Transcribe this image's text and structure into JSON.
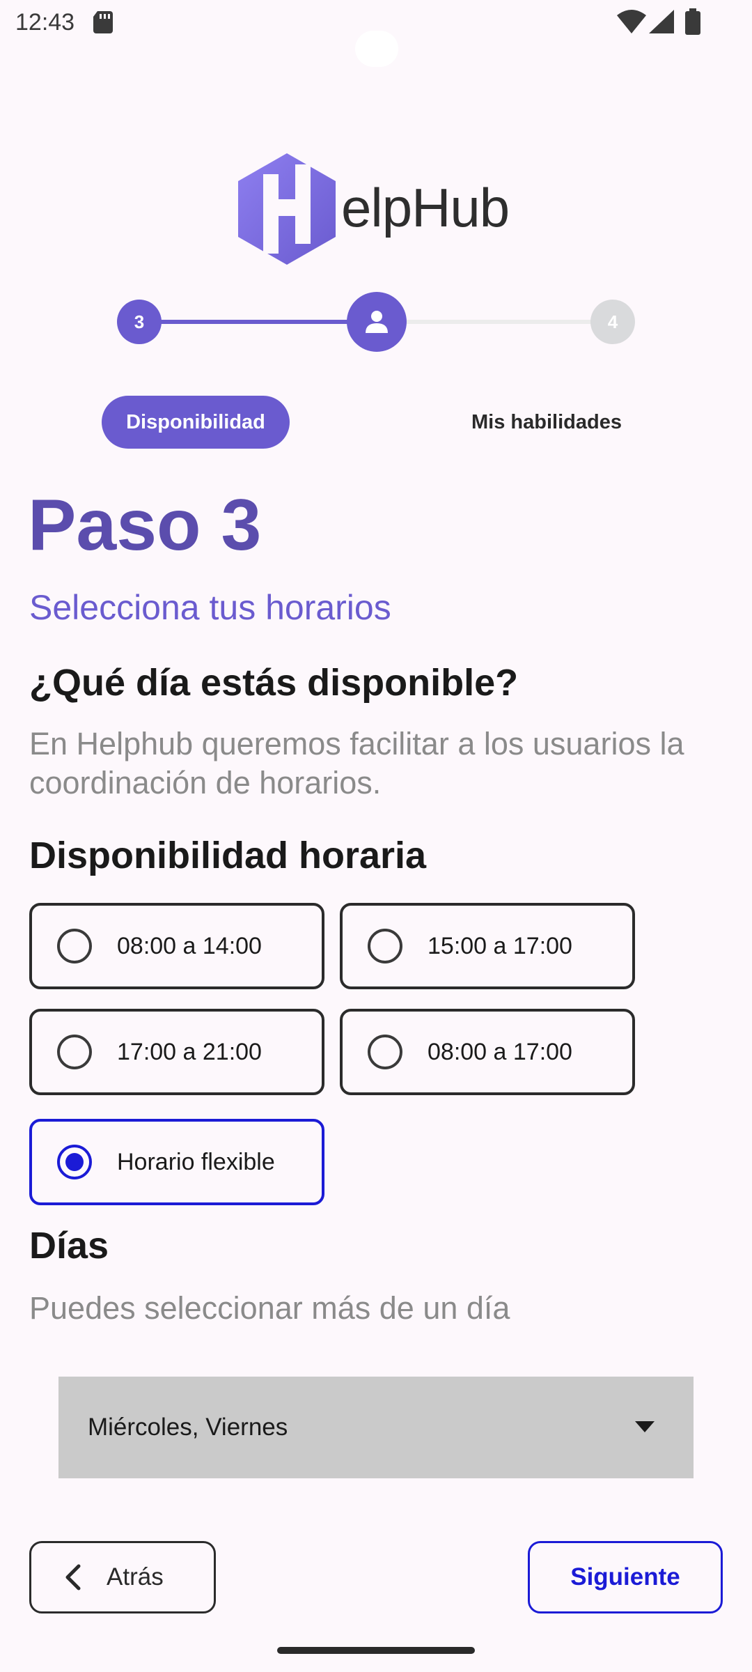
{
  "status_bar": {
    "time": "12:43",
    "icons": [
      "sd-card-icon",
      "wifi-icon",
      "signal-icon",
      "battery-icon"
    ]
  },
  "logo": {
    "text": "elpHub",
    "mark_letter": "H",
    "color": "#7b6ee0"
  },
  "stepper": {
    "step_prev": "3",
    "step_next": "4",
    "current_icon": "person-icon",
    "active_label": "Disponibilidad",
    "next_label": "Mis habilidades",
    "accent": "#6a5bcf",
    "inactive": "#d9dadc"
  },
  "content": {
    "title": "Paso 3",
    "subtitle": "Selecciona tus horarios",
    "question_title": "¿Qué día estás disponible?",
    "question_desc": "En Helphub queremos facilitar a los usuarios la coordinación de horarios.",
    "availability_title": "Disponibilidad horaria",
    "options": [
      {
        "label": "08:00 a 14:00",
        "selected": false
      },
      {
        "label": "15:00 a 17:00",
        "selected": false
      },
      {
        "label": "17:00 a 21:00",
        "selected": false
      },
      {
        "label": "08:00 a 17:00",
        "selected": false
      },
      {
        "label": "Horario flexible",
        "selected": true
      }
    ],
    "days_title": "Días",
    "days_desc": "Puedes seleccionar más de un día",
    "days_value": "Miércoles, Viernes"
  },
  "actions": {
    "back_label": "Atrás",
    "next_label": "Siguiente",
    "selected_color": "#1b1bd6"
  }
}
